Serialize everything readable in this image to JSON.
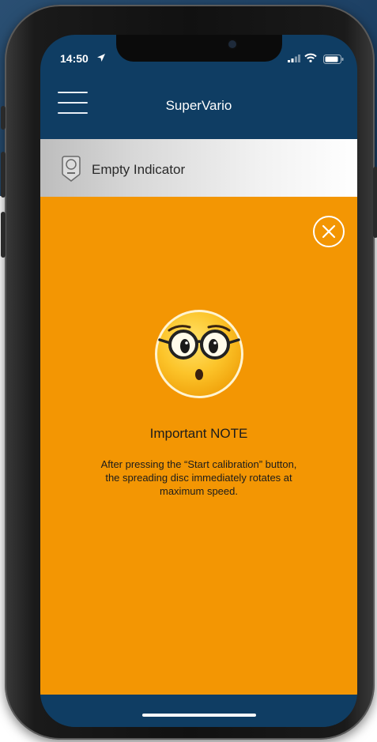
{
  "status_bar": {
    "time": "14:50"
  },
  "header": {
    "title": "SuperVario"
  },
  "section": {
    "title": "Empty Indicator"
  },
  "note": {
    "title": "Important NOTE",
    "body_line1": "After pressing the “Start calibration” button,",
    "body_line2": "the spreading disc immediately rotates at",
    "body_line3": "maximum speed."
  },
  "colors": {
    "header_bg": "#0f3d63",
    "content_bg": "#f39603",
    "text": "#1c1c1c"
  },
  "icons": [
    "menu-icon",
    "location-arrow-icon",
    "signal-icon",
    "wifi-icon",
    "battery-icon",
    "empty-indicator-icon",
    "close-icon",
    "nerd-face-emoji-icon"
  ]
}
